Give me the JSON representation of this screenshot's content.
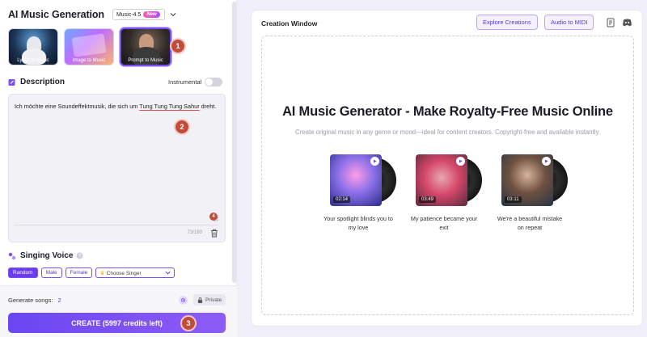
{
  "app": {
    "title": "AI Music Generation",
    "model": "Music-4.5",
    "model_badge": "New"
  },
  "modes": [
    {
      "label": "Lyrics to Music",
      "active": false
    },
    {
      "label": "Image to Music",
      "active": false
    },
    {
      "label": "Prompt to Music",
      "active": true
    }
  ],
  "markers": [
    "1",
    "2",
    "3",
    "4"
  ],
  "description": {
    "title": "Description",
    "instrumental_label": "Instrumental",
    "text_before": "Ich möchte eine Soundeffektmusik, die sich um ",
    "text_highlight": "Tung Tung Tung Sahur",
    "text_after": " dreht.",
    "char_count": "73/180"
  },
  "singing_voice": {
    "title": "Singing Voice",
    "options": [
      "Random",
      "Male",
      "Female"
    ],
    "selected": "Random",
    "singer_placeholder": "Choose Singer"
  },
  "footer": {
    "generate_label": "Generate songs:",
    "generate_value": "2",
    "private_label": "Private",
    "create_label": "CREATE (5997 credits left)"
  },
  "creation": {
    "window_title": "Creation Window",
    "explore_label": "Explore Creations",
    "midi_label": "Audio to MIDI",
    "hero_title": "AI Music Generator - Make Royalty-Free Music Online",
    "hero_subtitle": "Create original music in any genre or mood—ideal for content creators. Copyright-free and available instantly."
  },
  "songs": [
    {
      "duration": "02:14",
      "title": "Your spotlight blinds you to my love"
    },
    {
      "duration": "03:49",
      "title": "My patience became your exit"
    },
    {
      "duration": "03:11",
      "title": "We're a beautiful mistake on repeat"
    }
  ],
  "colors": {
    "accent": "#6a3df0",
    "marker": "#c24b3a",
    "background": "#f1f0fa"
  }
}
